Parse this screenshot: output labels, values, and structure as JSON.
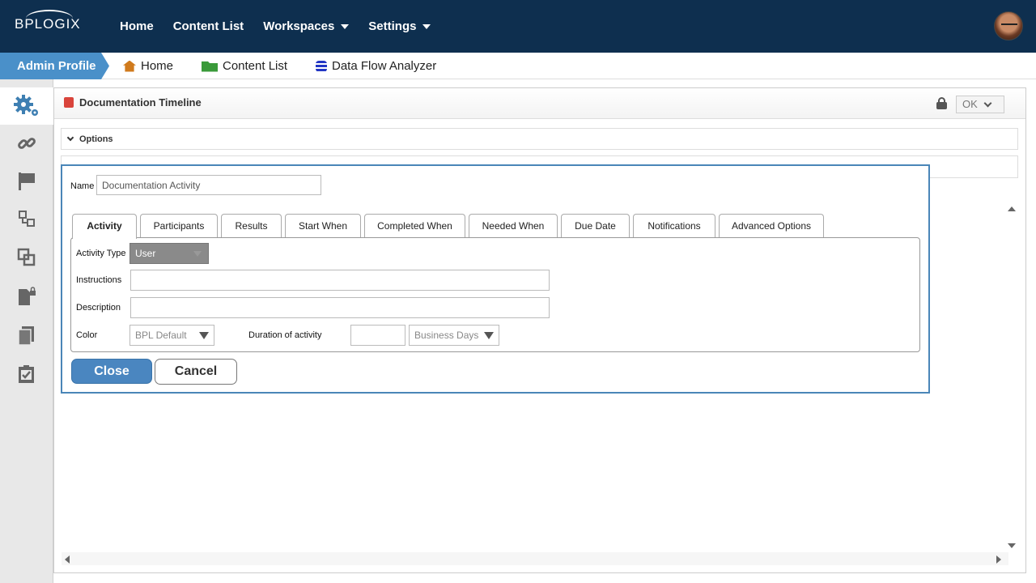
{
  "topbar": {
    "logo": "BPLOGIX",
    "nav": [
      {
        "label": "Home"
      },
      {
        "label": "Content List"
      },
      {
        "label": "Workspaces"
      },
      {
        "label": "Settings"
      }
    ]
  },
  "breadcrumb": {
    "profile": "Admin Profile",
    "items": [
      {
        "label": "Home"
      },
      {
        "label": "Content List"
      },
      {
        "label": "Data Flow Analyzer"
      }
    ]
  },
  "sidebar": {
    "items": [
      "gears-icon",
      "link-icon",
      "flag-icon",
      "nodes-icon",
      "copy-icon",
      "secure-document-icon",
      "documents-icon",
      "checklist-icon"
    ]
  },
  "panel": {
    "title": "Documentation Timeline",
    "ok_label": "OK",
    "options_label": "Options"
  },
  "dialog": {
    "name_label": "Name",
    "name_value": "Documentation Activity",
    "tabs": [
      "Activity",
      "Participants",
      "Results",
      "Start When",
      "Completed When",
      "Needed When",
      "Due Date",
      "Notifications",
      "Advanced Options"
    ],
    "active_tab": "Activity",
    "activity_type_label": "Activity Type",
    "activity_type_value": "User",
    "instructions_label": "Instructions",
    "instructions_value": "",
    "description_label": "Description",
    "description_value": "",
    "color_label": "Color",
    "color_value": "BPL Default",
    "duration_label": "Duration of activity",
    "duration_value": "",
    "duration_unit": "Business Days",
    "close_label": "Close",
    "cancel_label": "Cancel"
  },
  "colors": {
    "topbar": "#0e2f4f",
    "accent": "#4a90c9",
    "dialog_border": "#4a86b8",
    "close_button": "#4a86c0"
  }
}
